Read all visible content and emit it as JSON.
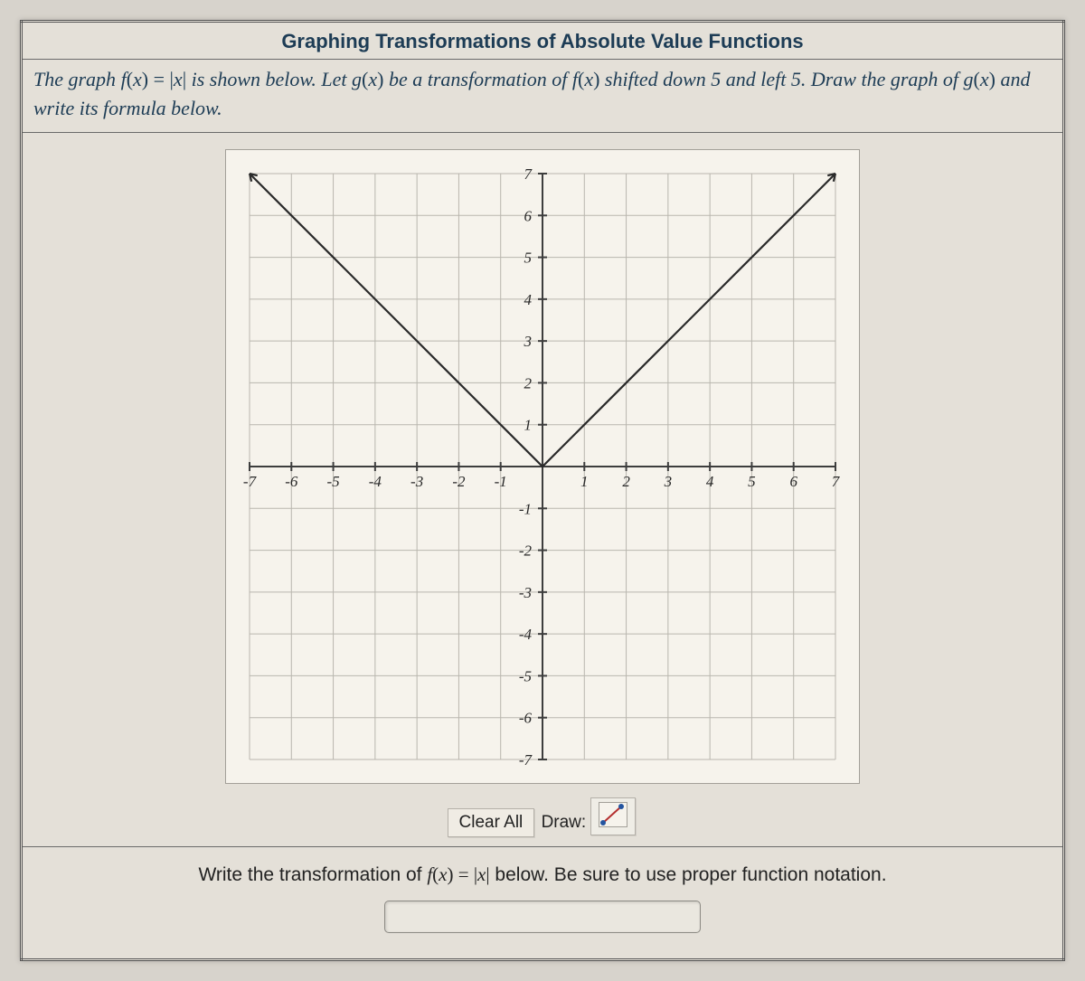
{
  "title": "Graphing Transformations of Absolute Value Functions",
  "prompt_html": "The graph <span class='math'>f</span><span class='math-up'>(</span><span class='math'>x</span><span class='math-up'>) = |</span><span class='math'>x</span><span class='math-up'>|</span> is shown below. Let <span class='math'>g</span><span class='math-up'>(</span><span class='math'>x</span><span class='math-up'>)</span> be a transformation of <span class='math'>f</span><span class='math-up'>(</span><span class='math'>x</span><span class='math-up'>)</span> shifted down 5 and left 5. Draw the graph of <span class='math'>g</span><span class='math-up'>(</span><span class='math'>x</span><span class='math-up'>)</span> and write its formula below.",
  "controls": {
    "clear_label": "Clear All",
    "draw_label": "Draw:"
  },
  "answer_prompt_html": "Write the transformation of <span class='math'>f</span><span class='math-up'>(</span><span class='math'>x</span><span class='math-up'>) = |</span><span class='math'>x</span><span class='math-up'>|</span> below. Be sure to use proper function notation.",
  "answer_value": "",
  "chart_data": {
    "type": "line",
    "x": [
      -7,
      -6,
      -5,
      -4,
      -3,
      -2,
      -1,
      0,
      1,
      2,
      3,
      4,
      5,
      6,
      7
    ],
    "series": [
      {
        "name": "f(x)=|x|",
        "values": [
          7,
          6,
          5,
          4,
          3,
          2,
          1,
          0,
          1,
          2,
          3,
          4,
          5,
          6,
          7
        ]
      }
    ],
    "xlim": [
      -7,
      7
    ],
    "ylim": [
      -7,
      7
    ],
    "x_ticks": [
      -7,
      -6,
      -5,
      -4,
      -3,
      -2,
      -1,
      1,
      2,
      3,
      4,
      5,
      6,
      7
    ],
    "y_ticks": [
      -7,
      -6,
      -5,
      -4,
      -3,
      -2,
      -1,
      1,
      2,
      3,
      4,
      5,
      6,
      7
    ],
    "title": "",
    "xlabel": "",
    "ylabel": "",
    "grid": true
  }
}
